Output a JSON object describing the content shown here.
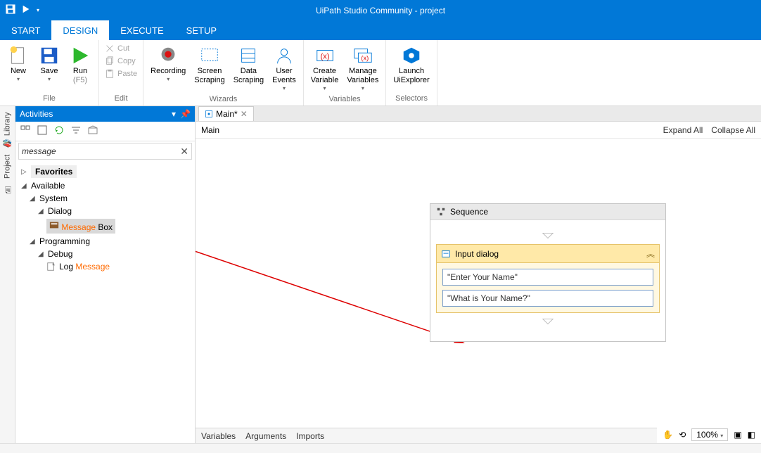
{
  "title": "UiPath Studio Community - project",
  "menuTabs": {
    "start": "START",
    "design": "DESIGN",
    "execute": "EXECUTE",
    "setup": "SETUP"
  },
  "ribbon": {
    "file": {
      "label": "File",
      "new": "New",
      "save": "Save",
      "run": "Run",
      "runKey": "(F5)"
    },
    "edit": {
      "label": "Edit",
      "cut": "Cut",
      "copy": "Copy",
      "paste": "Paste"
    },
    "wizards": {
      "label": "Wizards",
      "recording": "Recording",
      "screen": "Screen\nScraping",
      "data": "Data\nScraping",
      "user": "User\nEvents"
    },
    "variables": {
      "label": "Variables",
      "create": "Create\nVariable",
      "manage": "Manage\nVariables"
    },
    "selectors": {
      "label": "Selectors",
      "launch": "Launch\nUiExplorer"
    }
  },
  "leftRail": {
    "library": "Library",
    "project": "Project"
  },
  "activities": {
    "title": "Activities",
    "search": "message",
    "favorites": "Favorites",
    "available": "Available",
    "system": "System",
    "dialog": "Dialog",
    "messageBoxHl": "Message",
    "messageBoxRest": " Box",
    "programming": "Programming",
    "debug": "Debug",
    "logPrefix": "Log ",
    "logHl": "Message"
  },
  "designer": {
    "docTab": "Main*",
    "breadcrumb": "Main",
    "expandAll": "Expand All",
    "collapseAll": "Collapse All",
    "sequence": "Sequence",
    "inputDialog": "Input dialog",
    "field1": "\"Enter Your Name\"",
    "field2": "\"What is Your Name?\"",
    "bottom": {
      "variables": "Variables",
      "arguments": "Arguments",
      "imports": "Imports"
    },
    "zoom": "100%"
  }
}
